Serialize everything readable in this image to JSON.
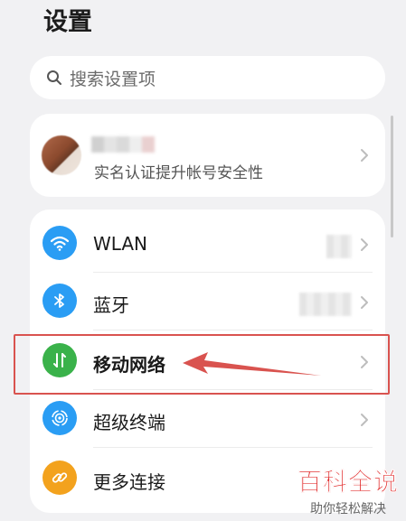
{
  "page": {
    "title": "设置"
  },
  "search": {
    "placeholder": "搜索设置项"
  },
  "account": {
    "subtitle": "实名认证提升帐号安全性"
  },
  "settings": [
    {
      "label": "WLAN",
      "icon": "wifi-icon",
      "color": "#2a9df4",
      "name": "wlan"
    },
    {
      "label": "蓝牙",
      "icon": "bluetooth-icon",
      "color": "#2a9df4",
      "name": "bluetooth"
    },
    {
      "label": "移动网络",
      "icon": "mobile-network-icon",
      "color": "#3ab24a",
      "name": "mobile-network"
    },
    {
      "label": "超级终端",
      "icon": "super-device-icon",
      "color": "#2a9df4",
      "name": "super-device"
    },
    {
      "label": "更多连接",
      "icon": "link-icon",
      "color": "#f3a21d",
      "name": "more-connections"
    }
  ],
  "annotation": {
    "highlight_color": "#d9534f"
  },
  "watermark": {
    "title": "百科全说",
    "subtitle": "助你轻松解决"
  }
}
